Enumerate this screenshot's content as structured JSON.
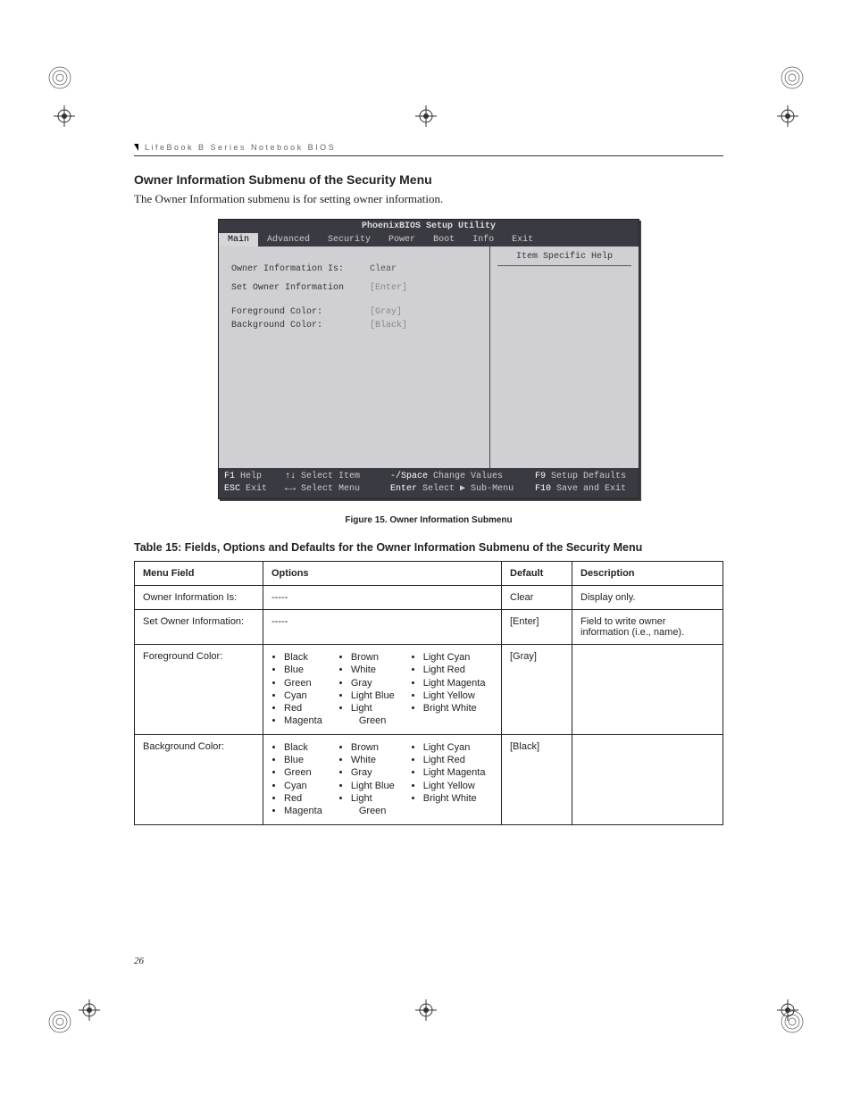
{
  "running_head": "LifeBook B Series Notebook BIOS",
  "section_title": "Owner Information Submenu of the Security Menu",
  "intro_text": "The Owner Information submenu is for setting owner information.",
  "bios": {
    "title": "PhoenixBIOS Setup Utility",
    "tabs": [
      "Main",
      "Advanced",
      "Security",
      "Power",
      "Boot",
      "Info",
      "Exit"
    ],
    "help_header": "Item Specific Help",
    "rows": [
      {
        "label": "Owner Information Is:",
        "value": "Clear",
        "inactive": false
      },
      {
        "label": "Set Owner Information",
        "value": "[Enter]",
        "inactive": true
      },
      {
        "label": "Foreground Color:",
        "value": "[Gray]",
        "inactive": true
      },
      {
        "label": "Background Color:",
        "value": "[Black]",
        "inactive": true
      }
    ],
    "footer": {
      "r1": {
        "k1": "F1",
        "t1": "Help",
        "k2": "↑↓",
        "t2": "Select Item",
        "k3": "-/Space",
        "t3": "Change Values",
        "k4": "F9",
        "t4": "Setup Defaults"
      },
      "r2": {
        "k1": "ESC",
        "t1": "Exit",
        "k2": "←→",
        "t2": "Select Menu",
        "k3": "Enter",
        "t3": "Select ▶ Sub-Menu",
        "k4": "F10",
        "t4": "Save and Exit"
      }
    }
  },
  "figure_caption": "Figure 15.   Owner Information Submenu",
  "table_title": "Table 15: Fields, Options and Defaults for the Owner Information Submenu of the Security Menu",
  "table": {
    "headers": [
      "Menu Field",
      "Options",
      "Default",
      "Description"
    ],
    "rows": [
      {
        "field": "Owner Information Is:",
        "options_plain": "-----",
        "default": "Clear",
        "description": "Display only."
      },
      {
        "field": "Set Owner Information:",
        "options_plain": "-----",
        "default": "[Enter]",
        "description": "Field to write owner information (i.e., name)."
      },
      {
        "field": "Foreground Color:",
        "options_cols": [
          [
            "Black",
            "Blue",
            "Green",
            "Cyan",
            "Red",
            "Magenta"
          ],
          [
            "Brown",
            "White",
            "Gray",
            "Light Blue",
            "Light Green"
          ],
          [
            "Light Cyan",
            "Light Red",
            "Light Magenta",
            "Light Yellow",
            "Bright White"
          ]
        ],
        "default": "[Gray]",
        "description": ""
      },
      {
        "field": "Background Color:",
        "options_cols": [
          [
            "Black",
            "Blue",
            "Green",
            "Cyan",
            "Red",
            "Magenta"
          ],
          [
            "Brown",
            "White",
            "Gray",
            "Light Blue",
            "Light Green"
          ],
          [
            "Light Cyan",
            "Light Red",
            "Light Magenta",
            "Light Yellow",
            "Bright White"
          ]
        ],
        "default": "[Black]",
        "description": ""
      }
    ]
  },
  "page_number": "26"
}
